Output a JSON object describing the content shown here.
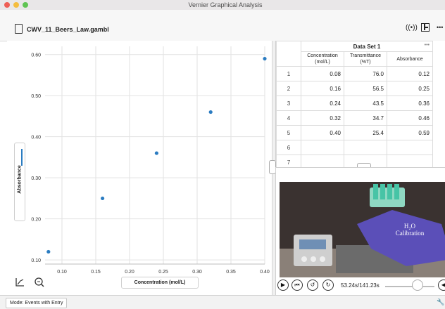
{
  "window": {
    "title": "Vernier Graphical Analysis"
  },
  "toolbar": {
    "file_name": "CWV_11_Beers_Law.gambl",
    "more": "•••"
  },
  "status": {
    "mode": "Mode: Events with Entry"
  },
  "table": {
    "dataset_title": "Data Set 1",
    "more": "•••",
    "columns": [
      {
        "label": "Concentration (mol/L)",
        "line1": "Concentration",
        "line2": "(mol/L)"
      },
      {
        "label": "Transmittance (%T)",
        "line1": "Transmittance",
        "line2": "(%T)"
      },
      {
        "label": "Absorbance",
        "line1": "Absorbance",
        "line2": ""
      }
    ],
    "rows": [
      [
        "1",
        "0.08",
        "76.0",
        "0.12"
      ],
      [
        "2",
        "0.16",
        "56.5",
        "0.25"
      ],
      [
        "3",
        "0.24",
        "43.5",
        "0.36"
      ],
      [
        "4",
        "0.32",
        "34.7",
        "0.46"
      ],
      [
        "5",
        "0.40",
        "25.4",
        "0.59"
      ],
      [
        "6",
        "",
        "",
        ""
      ],
      [
        "7",
        "",
        "",
        ""
      ]
    ]
  },
  "video": {
    "time": "53.24s/141.23s",
    "progress": 0.377,
    "overlay_line1": "H₂O",
    "overlay_line2": "Calibration"
  },
  "chart_data": {
    "type": "scatter",
    "xlabel": "Concentration (mol/L)",
    "ylabel": "Absorbance",
    "xlim": [
      0.075,
      0.4
    ],
    "ylim": [
      0.09,
      0.62
    ],
    "xticks": [
      "0.10",
      "0.15",
      "0.20",
      "0.25",
      "0.30",
      "0.35",
      "0.40"
    ],
    "yticks": [
      "0.10",
      "0.20",
      "0.30",
      "0.40",
      "0.50",
      "0.60"
    ],
    "x": [
      0.08,
      0.16,
      0.24,
      0.32,
      0.4
    ],
    "y": [
      0.12,
      0.25,
      0.36,
      0.46,
      0.59
    ],
    "grid": true,
    "point_color": "#2b7cc1"
  }
}
